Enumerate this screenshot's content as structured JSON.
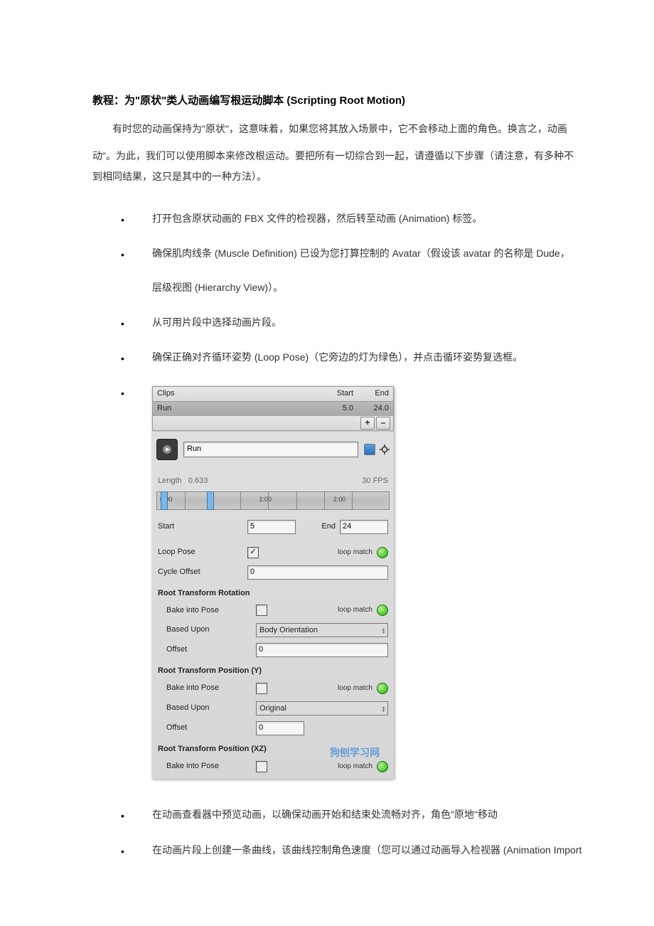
{
  "doc": {
    "title": "教程：为\"原状\"类人动画编写根运动脚本 (Scripting Root Motion)",
    "intro1": "有时您的动画保持为\"原状\"，这意味着，如果您将其放入场景中，它不会移动上面的角色。换言之，动画",
    "intro2": "动\"。为此，我们可以使用脚本来修改根运动。要把所有一切综合到一起，请遵循以下步骤（请注意，有多种不",
    "intro3": "到相同结果，这只是其中的一种方法）。",
    "bullets_top": [
      "打开包含原状动画的 FBX 文件的检视器，然后转至动画 (Animation) 标签。",
      "确保肌肉线条 (Muscle Definition) 已设为您打算控制的 Avatar（假设该 avatar 的名称是 Dude，",
      "从可用片段中选择动画片段。",
      "确保正确对齐循环姿势 (Loop Pose)（它旁边的灯为绿色），并点击循环姿势复选框。"
    ],
    "bullet_top_1_line2": "层级视图 (Hierarchy View)）。",
    "bullets_bottom": [
      "在动画查看器中预览动画，以确保动画开始和结束处流畅对齐，角色\"原地\"移动",
      "在动画片段上创建一条曲线，该曲线控制角色速度（您可以通过动画导入检视器 (Animation Import"
    ]
  },
  "inspector": {
    "clips_header": {
      "c1": "Clips",
      "c2": "Start",
      "c3": "End"
    },
    "clips_row": {
      "c1": "Run",
      "c2": "5.0",
      "c3": "24.0"
    },
    "btn_plus": "+",
    "btn_minus": "–",
    "clip_name": "Run",
    "length_label": "Length",
    "length_value": "0.633",
    "fps": "30 FPS",
    "timeline": {
      "t0": "0:00",
      "t1": "1:00",
      "t2": "2:00"
    },
    "start_label": "Start",
    "start_value": "5",
    "end_label": "End",
    "end_value": "24",
    "loop_pose_label": "Loop Pose",
    "loop_match": "loop match",
    "cycle_offset_label": "Cycle Offset",
    "cycle_offset_value": "0",
    "rt_rot": "Root Transform Rotation",
    "rt_posy": "Root Transform Position (Y)",
    "rt_posxz": "Root Transform Position (XZ)",
    "bake_label": "Bake into Pose",
    "based_label": "Based Upon",
    "offset_label": "Offset",
    "based_rot": "Body Orientation",
    "based_posy": "Original",
    "offset_rot": "0",
    "offset_posy": "0"
  },
  "watermark": {
    "cn": "狗刨学习网"
  }
}
